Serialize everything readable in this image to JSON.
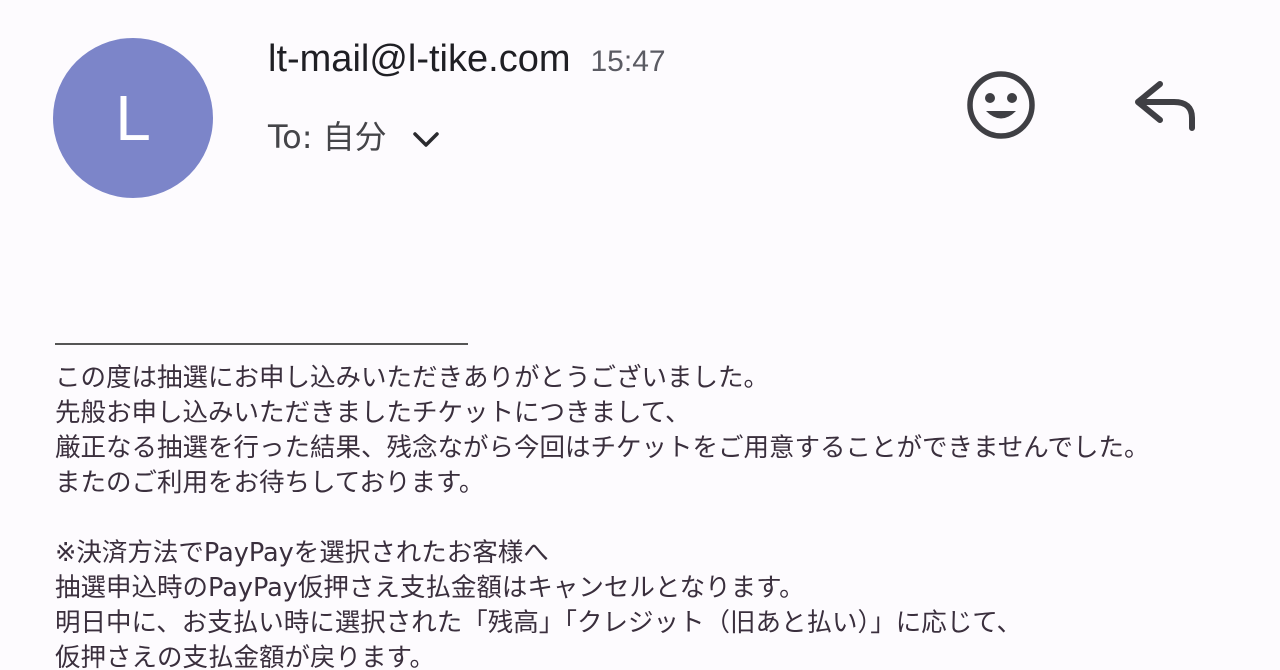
{
  "header": {
    "avatar_letter": "L",
    "avatar_color": "#7c85c9",
    "sender": "lt-mail@l-tike.com",
    "time": "15:47",
    "to": "To: 自分"
  },
  "icons": {
    "expand": "chevron-down-icon",
    "react": "smiley-face-icon",
    "reply": "reply-arrow-icon"
  },
  "body": {
    "paragraph1": [
      "この度は抽選にお申し込みいただきありがとうございました。",
      "先般お申し込みいただきましたチケットにつきまして、",
      "厳正なる抽選を行った結果、残念ながら今回はチケットをご用意することができませんでした。",
      "またのご利用をお待ちしております。"
    ],
    "paragraph2": [
      "※決済方法でPayPayを選択されたお客様へ",
      "抽選申込時のPayPay仮押さえ支払金額はキャンセルとなります。",
      "明日中に、お支払い時に選択された「残高」「クレジット（旧あと払い）」に応じて、",
      "仮押さえの支払金額が戻ります。"
    ]
  }
}
